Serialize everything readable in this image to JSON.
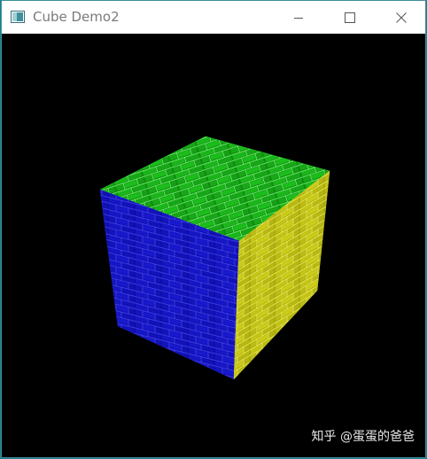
{
  "window": {
    "title": "Cube Demo2"
  },
  "icons": {
    "app": "app-window-icon",
    "minimize": "minimize-icon",
    "maximize": "maximize-icon",
    "close": "close-icon"
  },
  "scene": {
    "description_colors": {
      "top_face": "#19c619",
      "left_face": "#1414c8",
      "right_face": "#c8c814",
      "background": "#000000"
    }
  },
  "watermark": "知乎 @蛋蛋的爸爸"
}
